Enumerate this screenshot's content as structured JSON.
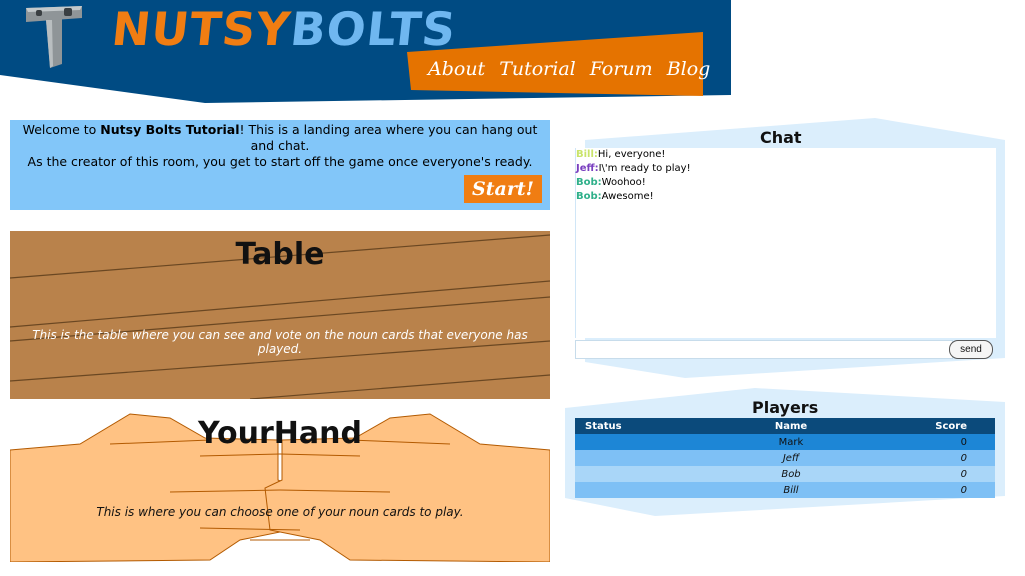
{
  "header": {
    "logo_word_1": "NUTSY",
    "logo_word_2": "BOLTS",
    "nav": [
      "About",
      "Tutorial",
      "Forum",
      "Blog"
    ]
  },
  "welcome": {
    "line1_prefix": "Welcome to ",
    "line1_bold": "Nutsy Bolts Tutorial",
    "line1_suffix": "! This is a landing area where you can hang out and chat.",
    "line2": "As the creator of this room, you get to start off the game once everyone's ready.",
    "start_label": "Start!"
  },
  "table": {
    "title": "Table",
    "description": "This is the table where you can see and vote on the noun cards that everyone has played."
  },
  "hand": {
    "title": "YourHand",
    "description": "This is where you can choose one of your noun cards to play."
  },
  "chat": {
    "title": "Chat",
    "messages": [
      {
        "name": "Bill:",
        "text": "Hi, everyone!",
        "color": "#c9e46a"
      },
      {
        "name": "Jeff:",
        "text": "I\\'m ready to play!",
        "color": "#7a3fc0"
      },
      {
        "name": "Bob:",
        "text": "Woohoo!",
        "color": "#2fb08a"
      },
      {
        "name": "Bob:",
        "text": "Awesome!",
        "color": "#2fb08a"
      }
    ],
    "input_value": "",
    "send_label": "send"
  },
  "players": {
    "title": "Players",
    "columns": [
      "Status",
      "Name",
      "Score"
    ],
    "rows": [
      {
        "status": "",
        "name": "Mark",
        "score": "0"
      },
      {
        "status": "",
        "name": "Jeff",
        "score": "0"
      },
      {
        "status": "",
        "name": "Bob",
        "score": "0"
      },
      {
        "status": "",
        "name": "Bill",
        "score": "0"
      }
    ]
  },
  "colors": {
    "header_blue": "#004b83",
    "accent_orange": "#f07d12",
    "logo_light_blue": "#6fb7f0",
    "welcome_blue": "#82c6f9",
    "table_wood": "#b9824b",
    "hand_skin": "#ffc283"
  }
}
